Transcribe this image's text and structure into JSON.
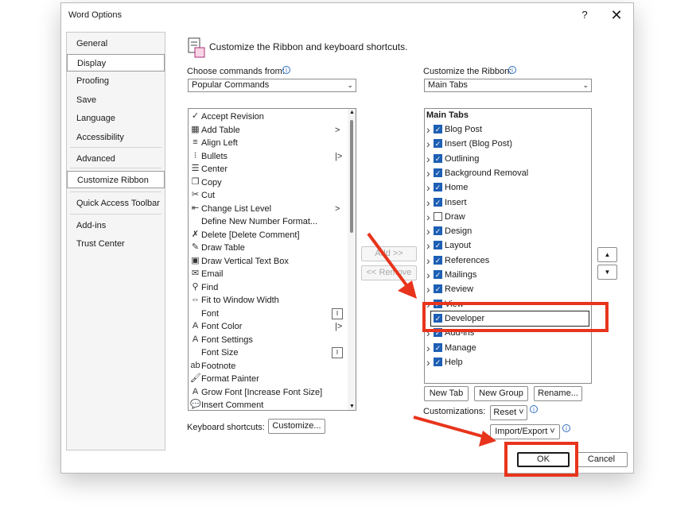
{
  "dialog": {
    "title": "Word Options",
    "help": "?",
    "close": "✕",
    "heading": "Customize the Ribbon and keyboard shortcuts."
  },
  "nav": {
    "items": [
      {
        "label": "General"
      },
      {
        "label": "Display"
      },
      {
        "label": "Proofing"
      },
      {
        "label": "Save"
      },
      {
        "label": "Language"
      },
      {
        "label": "Accessibility"
      },
      {
        "label": "Advanced"
      },
      {
        "label": "Customize Ribbon"
      },
      {
        "label": "Quick Access Toolbar"
      },
      {
        "label": "Add-ins"
      },
      {
        "label": "Trust Center"
      }
    ],
    "selected": "Customize Ribbon"
  },
  "left": {
    "label": "Choose commands from:",
    "combo_value": "Popular Commands",
    "commands": [
      {
        "label": "Accept Revision",
        "icon": "accept-revision-icon",
        "glyph": "✓"
      },
      {
        "label": "Add Table",
        "icon": "table-icon",
        "glyph": "▦",
        "sub": ">"
      },
      {
        "label": "Align Left",
        "icon": "align-left-icon",
        "glyph": "≡"
      },
      {
        "label": "Bullets",
        "icon": "bullets-icon",
        "glyph": "⁝",
        "sub": "|>"
      },
      {
        "label": "Center",
        "icon": "align-center-icon",
        "glyph": "☰"
      },
      {
        "label": "Copy",
        "icon": "copy-icon",
        "glyph": "❐"
      },
      {
        "label": "Cut",
        "icon": "scissors-icon",
        "glyph": "✂"
      },
      {
        "label": "Change List Level",
        "icon": "list-level-icon",
        "glyph": "⇤",
        "sub": ">"
      },
      {
        "label": "Define New Number Format...",
        "icon": "",
        "glyph": ""
      },
      {
        "label": "Delete [Delete Comment]",
        "icon": "delete-comment-icon",
        "glyph": "✗"
      },
      {
        "label": "Draw Table",
        "icon": "draw-table-icon",
        "glyph": "✎"
      },
      {
        "label": "Draw Vertical Text Box",
        "icon": "text-box-icon",
        "glyph": "▣"
      },
      {
        "label": "Email",
        "icon": "email-icon",
        "glyph": "✉"
      },
      {
        "label": "Find",
        "icon": "find-icon",
        "glyph": "⚲"
      },
      {
        "label": "Fit to Window Width",
        "icon": "fit-width-icon",
        "glyph": "⇔"
      },
      {
        "label": "Font",
        "icon": "",
        "glyph": "",
        "box": "I"
      },
      {
        "label": "Font Color",
        "icon": "font-color-icon",
        "glyph": "A",
        "sub": "|>"
      },
      {
        "label": "Font Settings",
        "icon": "font-settings-icon",
        "glyph": "A"
      },
      {
        "label": "Font Size",
        "icon": "",
        "glyph": "",
        "box": "I"
      },
      {
        "label": "Footnote",
        "icon": "footnote-icon",
        "glyph": "ab"
      },
      {
        "label": "Format Painter",
        "icon": "format-painter-icon",
        "glyph": "🖌"
      },
      {
        "label": "Grow Font [Increase Font Size]",
        "icon": "grow-font-icon",
        "glyph": "A"
      },
      {
        "label": "Insert Comment",
        "icon": "comment-icon",
        "glyph": "💬"
      }
    ],
    "keyboard_label": "Keyboard shortcuts:",
    "customize_btn": "Customize..."
  },
  "middle": {
    "add_btn": "Add >>",
    "remove_btn": "<< Remove"
  },
  "right": {
    "label": "Customize the Ribbon:",
    "combo_value": "Main Tabs",
    "tree_header": "Main Tabs",
    "tabs": [
      {
        "label": "Blog Post",
        "checked": true
      },
      {
        "label": "Insert (Blog Post)",
        "checked": true
      },
      {
        "label": "Outlining",
        "checked": true
      },
      {
        "label": "Background Removal",
        "checked": true
      },
      {
        "label": "Home",
        "checked": true
      },
      {
        "label": "Insert",
        "checked": true
      },
      {
        "label": "Draw",
        "checked": false
      },
      {
        "label": "Design",
        "checked": true
      },
      {
        "label": "Layout",
        "checked": true
      },
      {
        "label": "References",
        "checked": true
      },
      {
        "label": "Mailings",
        "checked": true
      },
      {
        "label": "Review",
        "checked": true
      },
      {
        "label": "View",
        "checked": true
      },
      {
        "label": "Developer",
        "checked": true
      },
      {
        "label": "Add-ins",
        "checked": true
      },
      {
        "label": "Manage",
        "checked": true
      },
      {
        "label": "Help",
        "checked": true
      }
    ],
    "new_tab_btn": "New Tab",
    "new_group_btn": "New Group",
    "rename_btn": "Rename...",
    "customizations_label": "Customizations:",
    "reset_btn": "Reset ˅",
    "import_export_btn": "Import/Export ˅",
    "move_up": "▲",
    "move_down": "▼"
  },
  "footer": {
    "ok_btn": "OK",
    "cancel_btn": "Cancel"
  },
  "colors": {
    "annotation": "#e8341c",
    "checkbox": "#1d5fb4"
  }
}
